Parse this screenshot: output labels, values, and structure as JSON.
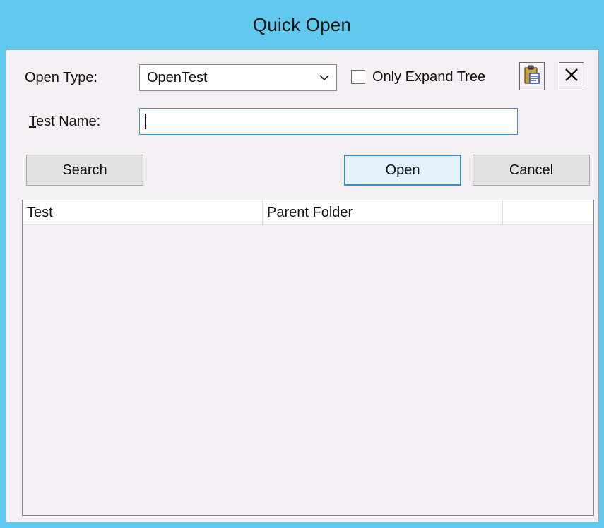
{
  "window": {
    "title": "Quick Open"
  },
  "open_type": {
    "label": "Open Type:",
    "selected": "OpenTest"
  },
  "only_expand_tree": {
    "label": "Only Expand Tree",
    "checked": false
  },
  "toolbar": {
    "paste_icon": "clipboard-paste-icon",
    "clear_icon": "close-x-icon"
  },
  "test_name": {
    "label": "Test Name:",
    "value": ""
  },
  "buttons": {
    "search": "Search",
    "open": "Open",
    "cancel": "Cancel"
  },
  "results": {
    "columns": [
      "Test",
      "Parent Folder",
      ""
    ],
    "rows": []
  },
  "colors": {
    "title_bar": "#62c9ee",
    "client_bg": "#f4f0f4",
    "default_button_border": "#3b8fd1"
  }
}
